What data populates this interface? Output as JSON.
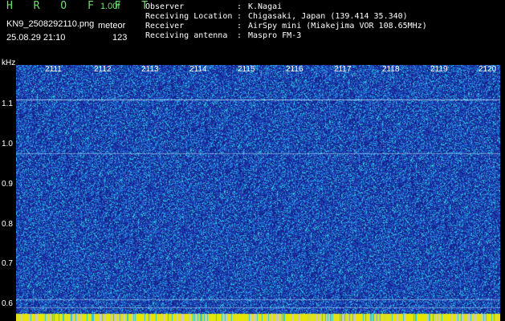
{
  "header": {
    "title": "H R O F F T",
    "version": "1.00f",
    "filename": "KN9_2508292110.png",
    "tag": "meteor",
    "datetime": "25.08.29 21:10",
    "count": "123"
  },
  "meta": [
    {
      "key": "Observer",
      "value": "K.Nagai"
    },
    {
      "key": "Receiving Location",
      "value": "Chigasaki, Japan (139.414 35.340)"
    },
    {
      "key": "Receiver",
      "value": "AirSpy mini (Miakejima VOR 108.65MHz)"
    },
    {
      "key": "Receiving antenna",
      "value": "Maspro FM-3"
    }
  ],
  "axis": {
    "y_unit": "kHz",
    "y_ticks": [
      "1.1",
      "1.0",
      "0.9",
      "0.8",
      "0.7",
      "0.6"
    ],
    "x_ticks": [
      "2111",
      "2112",
      "2113",
      "2114",
      "2115",
      "2116",
      "2117",
      "2118",
      "2119",
      "2120"
    ]
  },
  "colors": {
    "background": "#1a2a9a",
    "noise_high": "#2ec8d8",
    "noise_mid": "#1e60d8",
    "carrier": "#bfe8ff",
    "bottom_bar": "#e6e600",
    "label_green": "#6ee06e"
  }
}
